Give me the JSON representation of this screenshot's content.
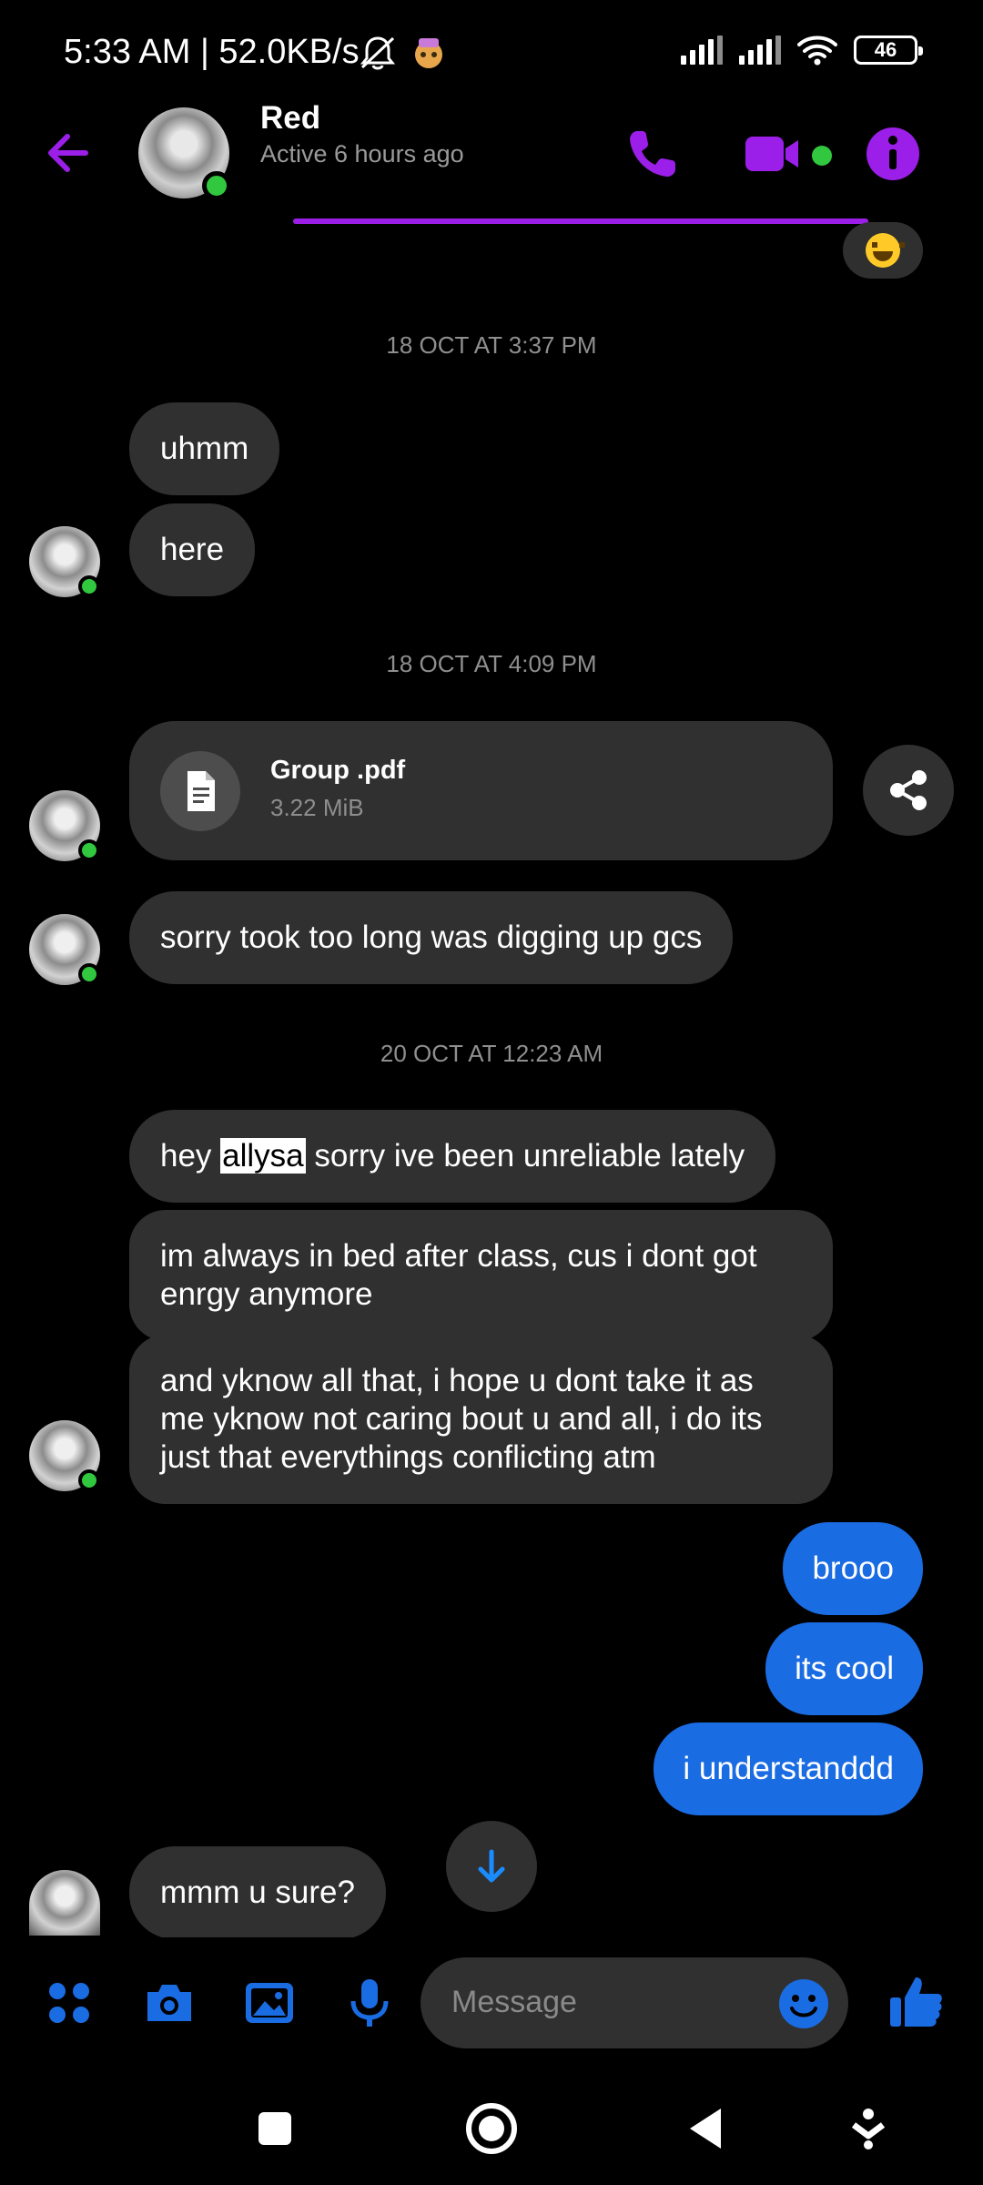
{
  "status_bar": {
    "time_and_speed": "5:33 AM | 52.0KB/s",
    "battery": "46"
  },
  "header": {
    "contact_name": "Red",
    "contact_status": "Active 6 hours ago"
  },
  "messages": {
    "ts1": "18 OCT AT 3:37 PM",
    "m1": "uhmm",
    "m2": "here",
    "ts2": "18 OCT AT 4:09 PM",
    "file": {
      "name": "Group .pdf",
      "size": "3.22 MiB"
    },
    "m3": "sorry took too long was digging up gcs",
    "ts3": "20 OCT AT 12:23 AM",
    "m4_pre": "hey ",
    "m4_highlight": "allysa",
    "m4_post": " sorry ive been unreliable lately",
    "m5": "im always in bed after class, cus i dont got enrgy anymore",
    "m6": "and yknow all that, i hope u dont take it as me yknow not caring bout u and all, i do its just that everythings conflicting atm",
    "mine1": "brooo",
    "mine2": "its cool",
    "mine3": "i understanddd",
    "m7": "mmm u sure?"
  },
  "composer": {
    "placeholder": "Message"
  },
  "colors": {
    "accent_purple": "#9b1fe8",
    "messenger_blue": "#1a6ce3",
    "online_green": "#31c73e",
    "bubble_gray": "#303030"
  }
}
